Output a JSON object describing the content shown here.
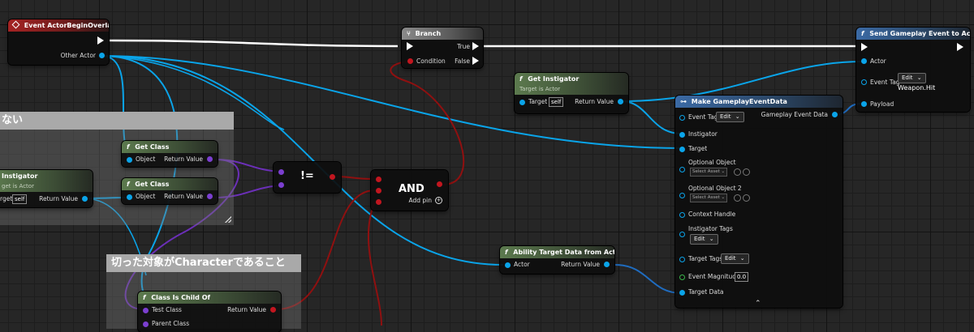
{
  "comments": {
    "left_title": "ない",
    "bottom_title": "切った対象がCharacterであること"
  },
  "event_node": {
    "title": "Event ActorBeginOverlap",
    "pin_other_actor": "Other Actor"
  },
  "branch_node": {
    "title": "Branch",
    "pin_condition": "Condition",
    "pin_true": "True",
    "pin_false": "False"
  },
  "send_event_node": {
    "title": "Send Gameplay Event to Actor",
    "pin_actor": "Actor",
    "pin_event_tag": "Event Tag",
    "event_tag_button": "Edit",
    "event_tag_value": "Weapon.Hit",
    "pin_payload": "Payload"
  },
  "get_instigator_top": {
    "title": "Get Instigator",
    "subtitle": "Target is Actor",
    "pin_target": "Target",
    "target_value": "self",
    "pin_return": "Return Value"
  },
  "get_instigator_left": {
    "title": "Instigator",
    "subtitle": "get is Actor",
    "pin_target": "rget",
    "target_value": "self",
    "pin_return": "Return Value"
  },
  "get_class_1": {
    "title": "Get Class",
    "pin_object": "Object",
    "pin_return": "Return Value"
  },
  "get_class_2": {
    "title": "Get Class",
    "pin_object": "Object",
    "pin_return": "Return Value"
  },
  "not_equal_node": {
    "label": "!="
  },
  "and_node": {
    "label": "AND",
    "add_pin": "Add pin"
  },
  "make_event_data": {
    "title": "Make GameplayEventData",
    "pin_event_tag": "Event Tag",
    "event_tag_button": "Edit",
    "pin_gameplay_event_data": "Gameplay Event Data",
    "pin_instigator": "Instigator",
    "pin_target": "Target",
    "pin_optional_object": "Optional Object",
    "select_asset_1": "Select Asset",
    "pin_optional_object_2": "Optional Object 2",
    "select_asset_2": "Select Asset",
    "pin_context_handle": "Context Handle",
    "pin_instigator_tags": "Instigator Tags",
    "instigator_tags_button": "Edit",
    "pin_target_tags": "Target Tags",
    "target_tags_button": "Edit",
    "pin_event_magnitude": "Event Magnitude",
    "event_magnitude_value": "0.0",
    "pin_target_data": "Target Data"
  },
  "ability_target_data": {
    "title": "Ability Target Data from Actor",
    "pin_actor": "Actor",
    "pin_return": "Return Value"
  },
  "class_is_child_of": {
    "title": "Class Is Child Of",
    "pin_test_class": "Test Class",
    "pin_parent_class": "Parent Class",
    "pin_return": "Return Value"
  },
  "icons": {
    "function": "function-icon",
    "event": "event-diamond-icon",
    "branch": "branch-icon",
    "collapse": "chevron-up-icon",
    "dropdown": "chevron-down-icon",
    "add": "add-pin-icon",
    "resize": "resize-grip-icon"
  },
  "colors": {
    "exec_wire": "#ffffff",
    "object_wire": "#0aa4e9",
    "class_wire": "#6b2fb8",
    "bool_wire": "#8f1010",
    "struct_wire": "#1f6cc0",
    "comment_title": "#a9a9a9"
  }
}
